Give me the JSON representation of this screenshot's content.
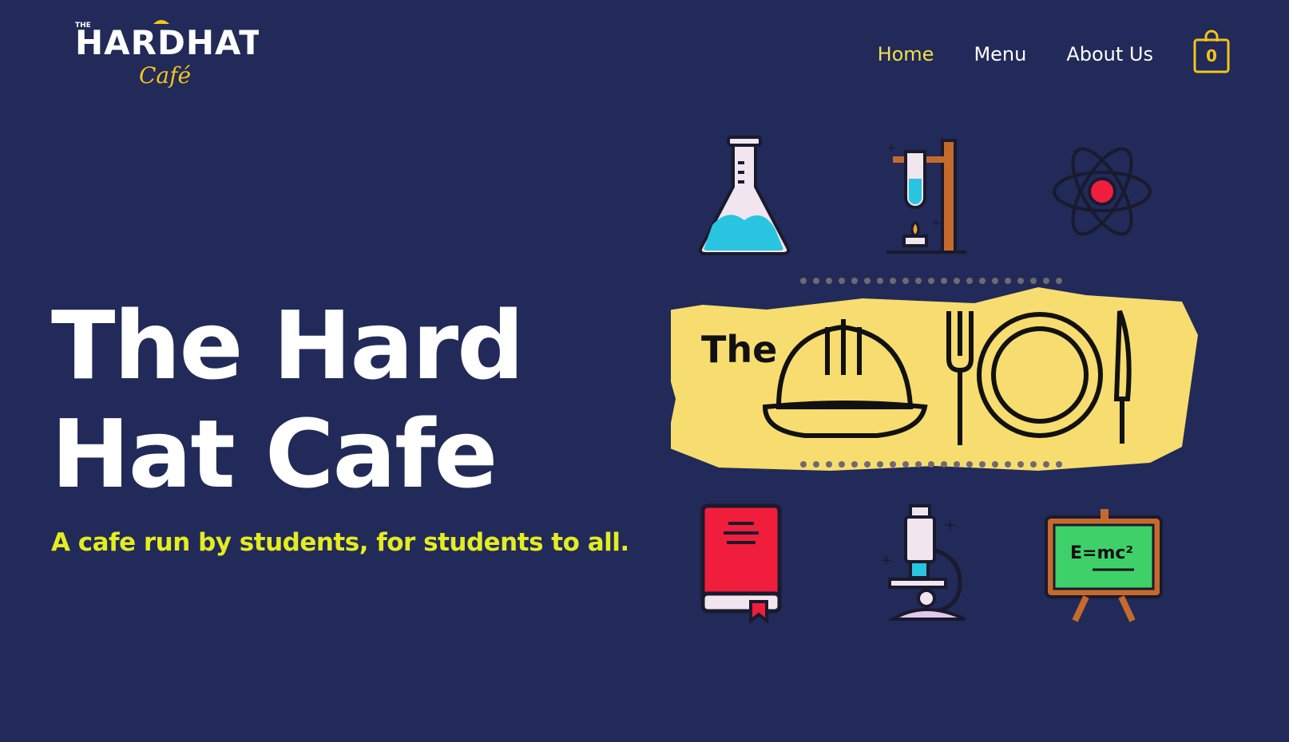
{
  "header": {
    "logo": {
      "small_text": "THE",
      "main_text": "HARDHAT",
      "script_text": "Café"
    },
    "nav": [
      {
        "label": "Home",
        "active": true
      },
      {
        "label": "Menu",
        "active": false
      },
      {
        "label": "About Us",
        "active": false
      }
    ],
    "cart": {
      "icon": "shopping-bag-icon",
      "count": "0"
    }
  },
  "hero": {
    "title_line1": "The Hard",
    "title_line2": "Hat Cafe",
    "subtitle": "A cafe run by students, for students to all.",
    "illustration": {
      "banner_text": "The",
      "icons": [
        "flask-icon",
        "test-tube-stand-icon",
        "atom-icon",
        "hardhat-icon",
        "fork-icon",
        "plate-icon",
        "knife-icon",
        "book-icon",
        "microscope-icon",
        "chalkboard-icon"
      ],
      "board_text": "E=mc²"
    }
  },
  "colors": {
    "background": "#212a58",
    "accent": "#f2e04a",
    "subtitle": "#e4ec22",
    "banner_yellow": "#f7dc6f"
  }
}
